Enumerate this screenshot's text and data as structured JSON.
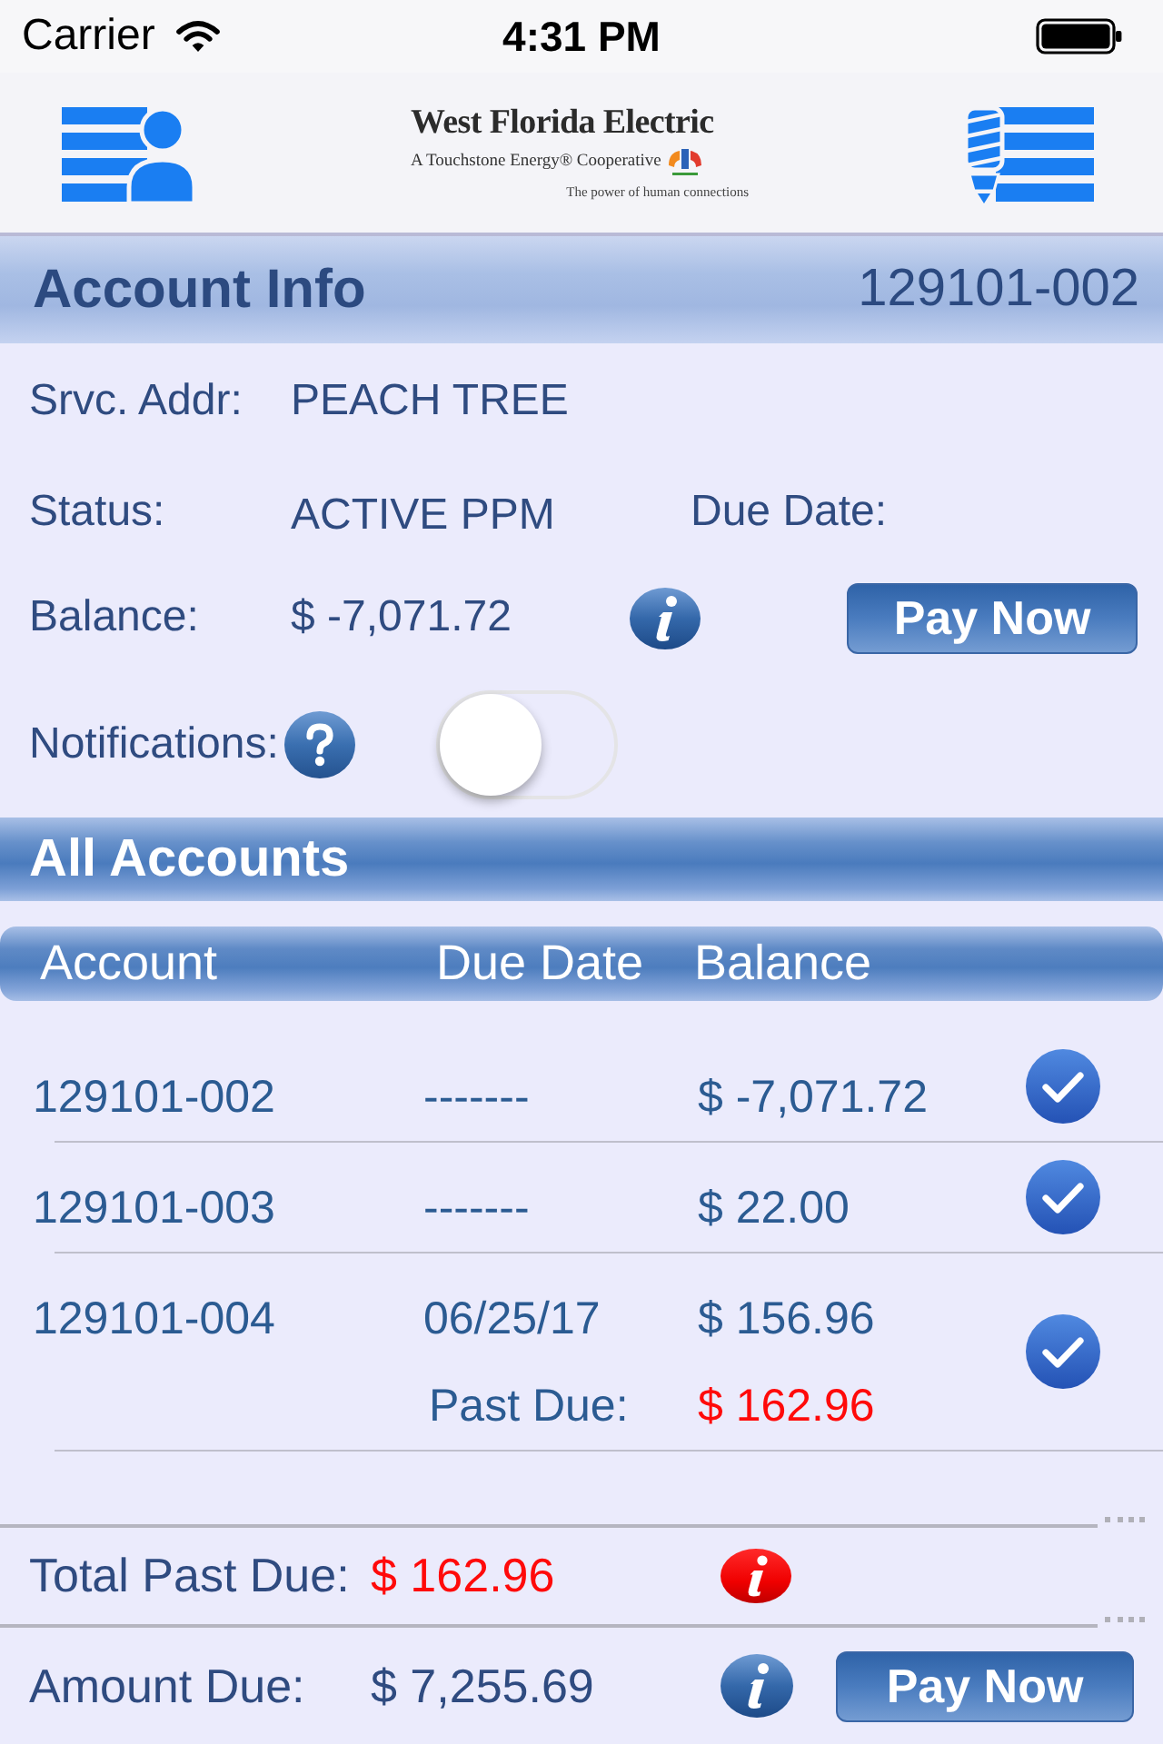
{
  "status_bar": {
    "carrier": "Carrier",
    "time": "4:31 PM"
  },
  "nav_bar": {
    "logo": {
      "title": "West Florida Electric",
      "tagline": "A Touchstone Energy® Cooperative",
      "motto": "The power of human connections"
    }
  },
  "account_info": {
    "title": "Account Info",
    "account_number": "129101-002",
    "service_address": {
      "label": "Srvc. Addr:",
      "value": "PEACH TREE"
    },
    "status": {
      "label": "Status:",
      "value": "ACTIVE PPM"
    },
    "due_date": {
      "label": "Due Date:"
    },
    "balance": {
      "label": "Balance:",
      "value": "$ -7,071.72"
    },
    "pay_button": "Pay Now",
    "notifications": {
      "label": "Notifications:",
      "on": false
    }
  },
  "all_accounts": {
    "title": "All Accounts",
    "columns": [
      "Account",
      "Due Date",
      "Balance"
    ],
    "rows": [
      {
        "account": "129101-002",
        "due_date": "-------",
        "balance": "$ -7,071.72",
        "checked": true
      },
      {
        "account": "129101-003",
        "due_date": "-------",
        "balance": "$ 22.00",
        "checked": true
      },
      {
        "account": "129101-004",
        "due_date": "06/25/17",
        "balance": "$ 156.96",
        "past_due": {
          "label": "Past Due:",
          "value": "$ 162.96"
        },
        "checked": true
      }
    ]
  },
  "totals": {
    "total_past_due": {
      "label": "Total Past Due:",
      "value": "$ 162.96"
    },
    "amount_due": {
      "label": "Amount Due:",
      "value": "$ 7,255.69"
    },
    "pay_button": "Pay Now"
  }
}
